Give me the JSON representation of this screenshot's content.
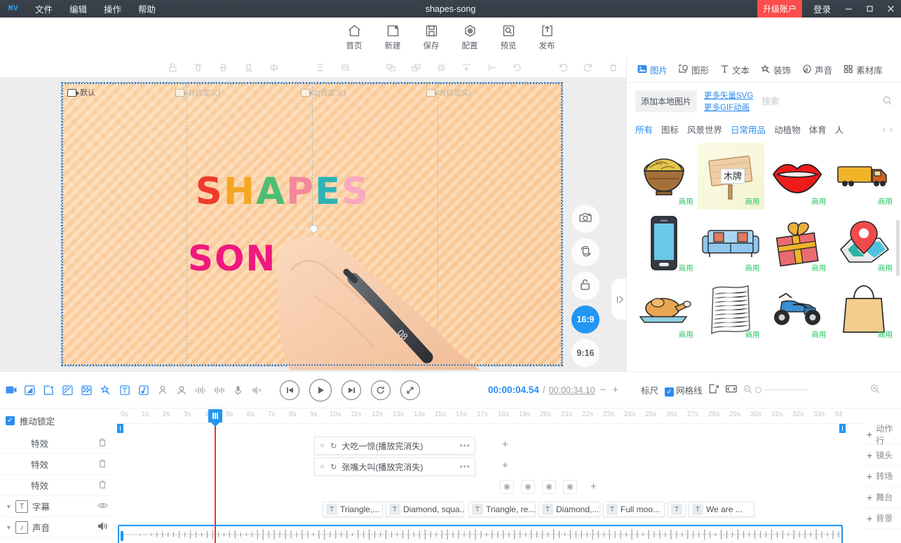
{
  "titlebar": {
    "logo": "MV",
    "menus": [
      "文件",
      "编辑",
      "操作",
      "帮助"
    ],
    "project_title": "shapes-song",
    "upgrade_label": "升级账户",
    "login_label": "登录",
    "minimize": "—",
    "maximize": "▢",
    "close": "✕",
    "accent_red": "#fc4c4c"
  },
  "toolbar": {
    "items": [
      {
        "icon": "home-icon",
        "label": "首页"
      },
      {
        "icon": "new-file-icon",
        "label": "新建"
      },
      {
        "icon": "save-icon",
        "label": "保存"
      },
      {
        "icon": "settings-icon",
        "label": "配置"
      },
      {
        "icon": "preview-icon",
        "label": "预览"
      },
      {
        "icon": "publish-icon",
        "label": "发布"
      }
    ]
  },
  "align_toolbar": {
    "tools": [
      "lock-icon",
      "align-top-icon",
      "align-middle-icon",
      "align-bottom-icon",
      "align-center-icon",
      "distribute-h-icon",
      "distribute-v-icon",
      "bring-front-icon",
      "send-back-icon",
      "group-icon",
      "flip-h-icon",
      "flip-v-icon",
      "rotate-icon"
    ],
    "history": [
      "undo-icon",
      "redo-icon",
      "delete-icon"
    ]
  },
  "canvas": {
    "scenes": [
      {
        "label": "默认",
        "active": true
      },
      {
        "label": "1(自定义)",
        "active": false
      },
      {
        "label": "2(自定义)",
        "active": false
      },
      {
        "label": "3(自定义)",
        "active": false
      }
    ],
    "title_letters": [
      {
        "ch": "S",
        "color": "#ef3b2c"
      },
      {
        "ch": "H",
        "color": "#f5a623"
      },
      {
        "ch": "A",
        "color": "#4dbd74"
      },
      {
        "ch": "P",
        "color": "#f4879b"
      },
      {
        "ch": "E",
        "color": "#2fb3b8"
      },
      {
        "ch": "S",
        "color": "#f9a8c0"
      }
    ],
    "subtitle_text": "SON",
    "subtitle_color": "#f0197f",
    "tools": [
      {
        "icon": "add-photo-icon",
        "label": "",
        "active": false
      },
      {
        "icon": "replace-media-icon",
        "label": "",
        "active": false
      },
      {
        "icon": "unlock-icon",
        "label": "",
        "active": false
      },
      {
        "icon": "ratio-icon",
        "label": "16:9",
        "active": true
      },
      {
        "icon": "ratio-icon",
        "label": "9:16",
        "active": false
      },
      {
        "icon": "edit-pen-icon",
        "label": "",
        "active": false
      }
    ]
  },
  "right_panel": {
    "tabs": [
      {
        "icon": "image-icon",
        "label": "图片",
        "active": true
      },
      {
        "icon": "shape-icon",
        "label": "图形",
        "active": false
      },
      {
        "icon": "text-icon",
        "label": "文本",
        "active": false
      },
      {
        "icon": "decoration-icon",
        "label": "装饰",
        "active": false
      },
      {
        "icon": "sound-icon",
        "label": "声音",
        "active": false
      },
      {
        "icon": "library-icon",
        "label": "素材库",
        "active": false
      }
    ],
    "add_local_label": "添加本地图片",
    "link_svg": "更多矢量SVG",
    "link_gif": "更多GIF动画",
    "search_placeholder": "搜索",
    "search_value": "",
    "categories": [
      {
        "label": "所有",
        "active": true
      },
      {
        "label": "图标",
        "active": false
      },
      {
        "label": "风景世界",
        "active": false
      },
      {
        "label": "日常用品",
        "active": true
      },
      {
        "label": "动植物",
        "active": false
      },
      {
        "label": "体育",
        "active": false
      },
      {
        "label": "人",
        "active": false
      }
    ],
    "prev_arrow": "‹",
    "next_arrow": "›",
    "items": [
      {
        "name": "noodle-bowl",
        "tag": "商用",
        "highlight": false
      },
      {
        "name": "wooden-sign",
        "tag": "商用",
        "highlight": true
      },
      {
        "name": "red-lips",
        "tag": "商用",
        "highlight": false
      },
      {
        "name": "cargo-truck",
        "tag": "商用",
        "highlight": false
      },
      {
        "name": "smartphone",
        "tag": "商用",
        "highlight": false
      },
      {
        "name": "blue-sofa",
        "tag": "商用",
        "highlight": false
      },
      {
        "name": "gift-box",
        "tag": "商用",
        "highlight": false
      },
      {
        "name": "map-pin",
        "tag": "商用",
        "highlight": false
      },
      {
        "name": "roast-chicken",
        "tag": "商用",
        "highlight": false
      },
      {
        "name": "paper-sheet",
        "tag": "商用",
        "highlight": false
      },
      {
        "name": "motorcycle",
        "tag": "商用",
        "highlight": false
      },
      {
        "name": "shopping-bag",
        "tag": "商用",
        "highlight": false
      }
    ],
    "sign_text": "木牌"
  },
  "playbar": {
    "tools": [
      "video-clip-icon",
      "transition-icon",
      "export-frame-icon",
      "crop-icon",
      "mosaic-icon",
      "sticker-icon",
      "text-box-icon",
      "music-icon",
      "person-icon",
      "avatar-icon",
      "audio-levels-icon",
      "waveform-icon",
      "microphone-icon",
      "mute-icon"
    ],
    "transport": [
      "skip-start-icon",
      "play-icon",
      "skip-end-icon",
      "replay-icon",
      "fullscreen-icon"
    ],
    "current_time": "00:00:04.54",
    "separator": "/",
    "total_time": "00:00:34.10",
    "minus": "−",
    "plus": "+",
    "ruler_label": "标尺",
    "grid_label": "网格线",
    "grid_checked": true,
    "extra_icons": [
      "clear-selection-icon",
      "fit-width-icon"
    ],
    "zoom_out": "⊖",
    "zoom_in": "⊕"
  },
  "timeline": {
    "lock_label": "推动锁定",
    "lock_checked": true,
    "tracks": [
      {
        "name": "特效",
        "icon": "",
        "action": "delete-icon",
        "caret": false
      },
      {
        "name": "特效",
        "icon": "",
        "action": "delete-icon",
        "caret": false
      },
      {
        "name": "特效",
        "icon": "",
        "action": "delete-icon",
        "caret": false
      },
      {
        "name": "字幕",
        "icon": "T",
        "action": "eye-icon",
        "caret": true
      },
      {
        "name": "声音",
        "icon": "♪",
        "action": "speaker-icon",
        "caret": true
      }
    ],
    "ruler_ticks": [
      "0s",
      "1s",
      "2s",
      "3s",
      "4s",
      "5s",
      "6s",
      "7s",
      "8s",
      "9s",
      "10s",
      "11s",
      "12s",
      "13s",
      "14s",
      "15s",
      "16s",
      "17s",
      "18s",
      "19s",
      "20s",
      "21s",
      "22s",
      "23s",
      "24s",
      "25s",
      "26s",
      "27s",
      "28s",
      "29s",
      "30s",
      "31s",
      "32s",
      "33s",
      "34"
    ],
    "fx_clips": [
      {
        "label": "大吃一惊(播放完消失)",
        "row": 0
      },
      {
        "label": "张嘴大叫(播放完消失)",
        "row": 1
      }
    ],
    "mini_fx_count": 4,
    "subtitle_clips": [
      "Triangle,...",
      "Diamond, squa...",
      "Triangle, re...",
      "Diamond,...",
      "Full moo...",
      "",
      "We are ..."
    ],
    "add_buttons": [
      {
        "plus": "+",
        "label": "动作行"
      },
      {
        "plus": "+",
        "label": "镜头"
      },
      {
        "plus": "+",
        "label": "转场"
      },
      {
        "plus": "+",
        "label": "舞台"
      },
      {
        "plus": "+",
        "label": "背景"
      }
    ]
  }
}
